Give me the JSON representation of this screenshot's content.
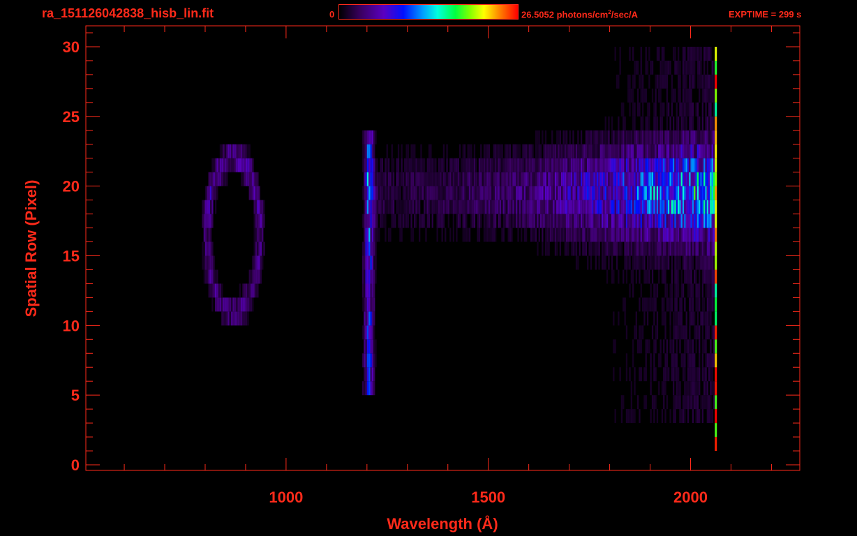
{
  "header": {
    "filename": "ra_151126042838_hisb_lin.fit",
    "colorbar_min": "0",
    "colorbar_max_value": "26.5052 photons/cm",
    "colorbar_max_exp": "2",
    "colorbar_max_unit": "/sec/A",
    "exptime": "EXPTIME = 299 s"
  },
  "chart_data": {
    "type": "heatmap",
    "title": "",
    "xlabel": "Wavelength (Å)",
    "ylabel": "Spatial Row (Pixel)",
    "xlim": [
      505,
      2270
    ],
    "ylim": [
      -0.4,
      31.5
    ],
    "x_ticks": [
      1000,
      1500,
      2000
    ],
    "y_ticks": [
      0,
      5,
      10,
      15,
      20,
      25,
      30
    ],
    "x_minor_step": 100,
    "y_minor_step": 1,
    "colormap": "rainbow",
    "value_range": [
      0,
      26.5052
    ],
    "value_unit": "photons/cm^2/sec/A",
    "features": [
      {
        "name": "Lyman-alpha ring",
        "x_center": 870,
        "x_halfwidth": 65,
        "y_center": 16.5,
        "y_halfheight": 5.5
      },
      {
        "name": "Lyman-alpha slit column",
        "x_center": 1205,
        "x_halfwidth": 12,
        "y_range": [
          5,
          24
        ]
      },
      {
        "name": "continuum band",
        "x_range": [
          1200,
          2060
        ],
        "y_range": [
          15,
          23
        ],
        "peak_x": 1990,
        "peak_y": 19.5
      },
      {
        "name": "detector edge",
        "x": 2060,
        "y_range": [
          1,
          30
        ]
      }
    ],
    "colors": {
      "axis": "#ff2a1a",
      "background": "#000000"
    }
  }
}
